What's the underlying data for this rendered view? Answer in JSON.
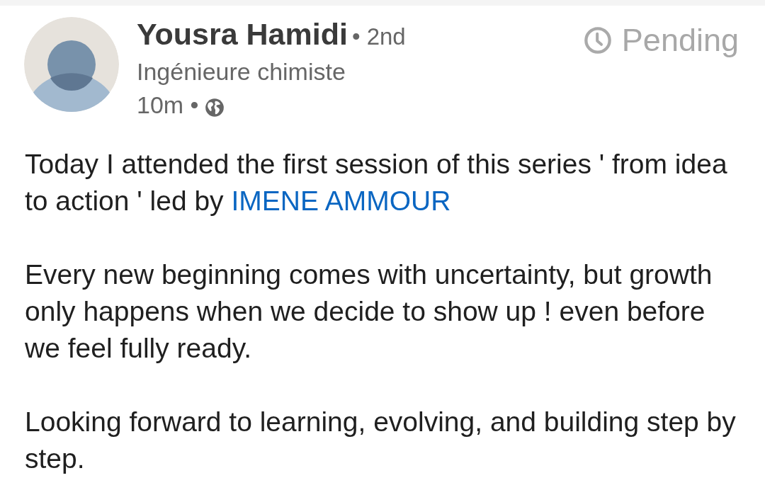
{
  "author": {
    "name": "Yousra Hamidi",
    "degree": "• 2nd",
    "headline": "Ingénieure chimiste",
    "time": "10m •"
  },
  "status": {
    "label": "Pending"
  },
  "post": {
    "paragraphs": [
      {
        "parts": [
          {
            "kind": "text",
            "text": "Today I attended the first session of this series ' from idea to action ' led by "
          },
          {
            "kind": "mention",
            "text": "IMENE AMMOUR"
          }
        ]
      },
      {
        "parts": [
          {
            "kind": "text",
            "text": "Every new beginning comes with uncertainty, but growth only happens when we decide to show up ! even before we feel fully ready."
          }
        ]
      },
      {
        "parts": [
          {
            "kind": "text",
            "text": "Looking forward to learning, evolving, and building step by step."
          }
        ]
      }
    ]
  }
}
